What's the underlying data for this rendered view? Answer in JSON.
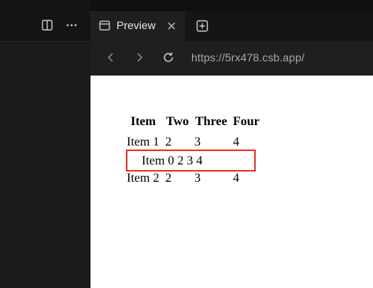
{
  "left_panel": {
    "icons": [
      "split-panel-icon",
      "more-icon"
    ]
  },
  "tabs": {
    "active_label": "Preview",
    "active_icon": "browser-window-icon",
    "close_icon": "close-icon",
    "new_tab_icon": "plus-square-icon"
  },
  "address_bar": {
    "url": "https://5rx478.csb.app/",
    "back_icon": "chevron-left-icon",
    "forward_icon": "chevron-right-icon",
    "reload_icon": "reload-icon"
  },
  "table": {
    "headers": [
      "Item",
      "Two",
      "Three",
      "Four"
    ],
    "rows": [
      [
        "Item 1",
        "2",
        "3",
        "4"
      ],
      [
        "Item 0 2 3 4"
      ],
      [
        "Item 2",
        "2",
        "3",
        "4"
      ]
    ]
  },
  "colors": {
    "highlight": "#e2382b",
    "panel_bg": "#1b1b1c",
    "preview_bg": "#ffffff"
  }
}
